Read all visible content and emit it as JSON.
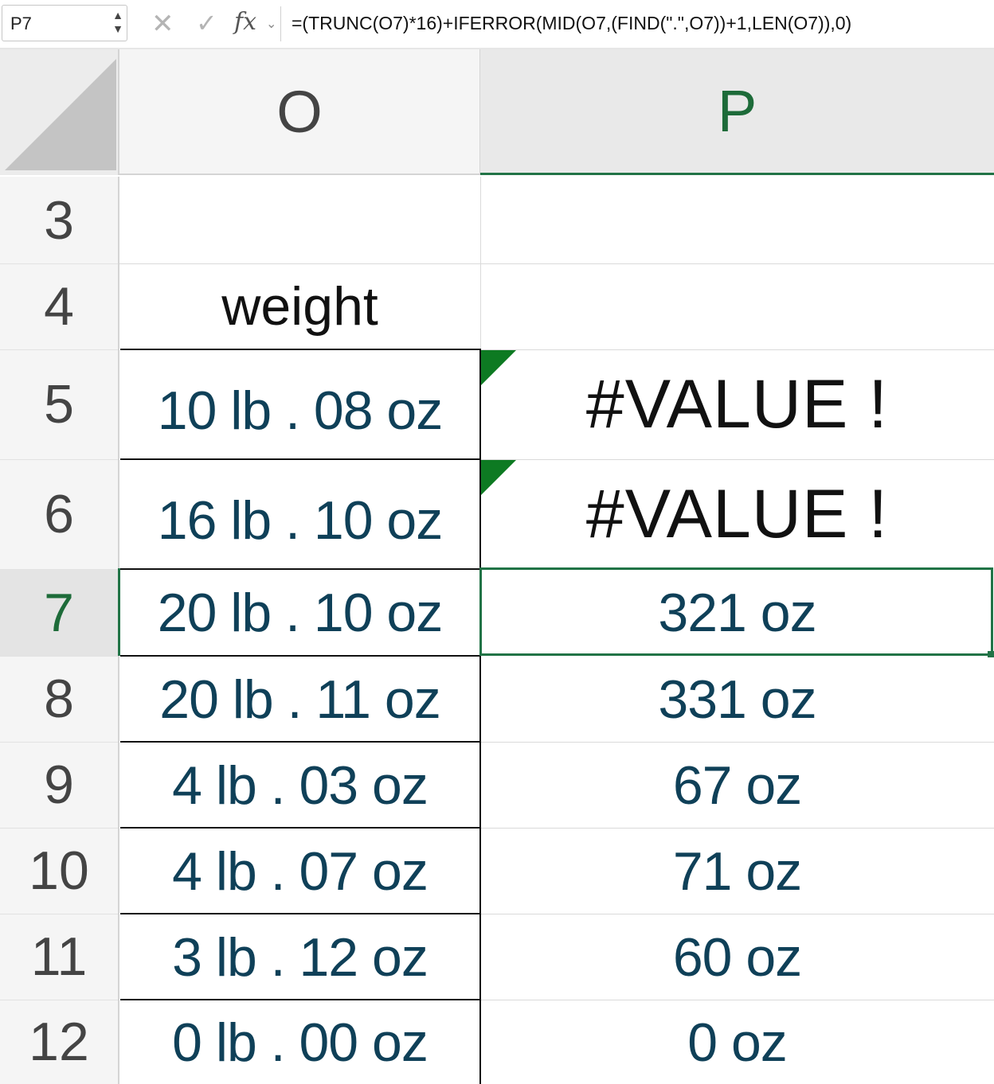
{
  "formula_bar": {
    "cell_reference": "P7",
    "formula": "=(TRUNC(O7)*16)+IFERROR(MID(O7,(FIND(\".\",O7))+1,LEN(O7)),0)",
    "icons": [
      "cancel-icon",
      "enter-icon",
      "fx-icon"
    ],
    "fx_label": "fx"
  },
  "columns": [
    {
      "letter": "O",
      "active": false
    },
    {
      "letter": "P",
      "active": true
    }
  ],
  "rows": [
    {
      "num": "3",
      "o": "",
      "p": "",
      "active": false
    },
    {
      "num": "4",
      "o": "weight",
      "p": "",
      "active": false
    },
    {
      "num": "5",
      "o": "10 lb . 08 oz",
      "p": "#VALUE !",
      "active": false,
      "error": true
    },
    {
      "num": "6",
      "o": "16 lb . 10 oz",
      "p": "#VALUE !",
      "active": false,
      "error": true
    },
    {
      "num": "7",
      "o": "20 lb . 10 oz",
      "p": "321 oz",
      "active": true
    },
    {
      "num": "8",
      "o": "20 lb . 11 oz",
      "p": "331 oz",
      "active": false
    },
    {
      "num": "9",
      "o": "4 lb . 03 oz",
      "p": "67 oz",
      "active": false
    },
    {
      "num": "10",
      "o": "4 lb . 07 oz",
      "p": "71 oz",
      "active": false
    },
    {
      "num": "11",
      "o": "3 lb . 12 oz",
      "p": "60 oz",
      "active": false
    },
    {
      "num": "12",
      "o": "0 lb . 00 oz",
      "p": "0 oz",
      "active": false
    }
  ],
  "colors": {
    "accent": "#217346",
    "cell_text": "#0f4058",
    "error_flag": "#0d7a22"
  }
}
